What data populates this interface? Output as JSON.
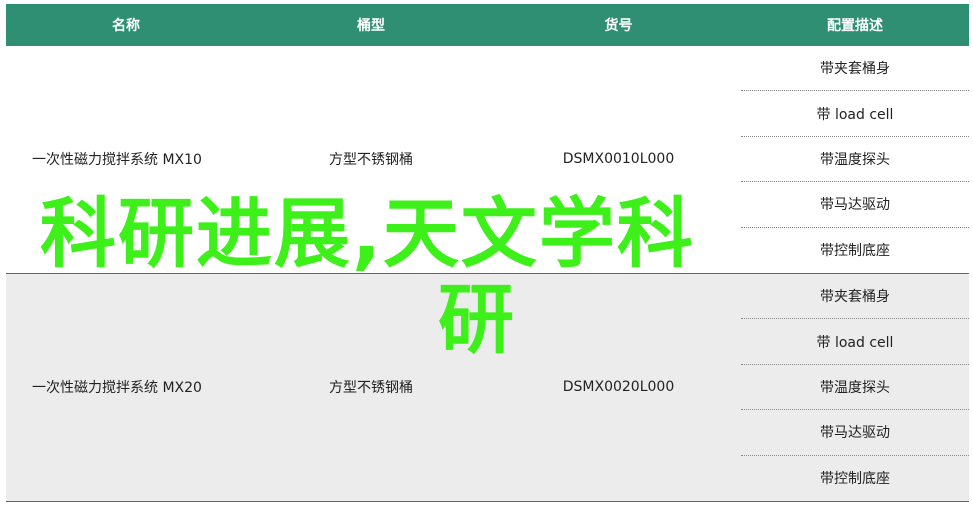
{
  "table": {
    "headers": [
      "名称",
      "桶型",
      "货号",
      "配置描述"
    ],
    "groups": [
      {
        "name": "一次性磁力搅拌系统 MX10",
        "barrel": "方型不锈钢桶",
        "sku": "DSMX0010L000",
        "configs": [
          "带夹套桶身",
          "带 load cell",
          "带温度探头",
          "带马达驱动",
          "带控制底座"
        ]
      },
      {
        "name": "一次性磁力搅拌系统 MX20",
        "barrel": "方型不锈钢桶",
        "sku": "DSMX0020L000",
        "configs": [
          "带夹套桶身",
          "带 load cell",
          "带温度探头",
          "带马达驱动",
          "带控制底座"
        ]
      }
    ]
  },
  "overlay": {
    "line1": "科研进展,天文学科",
    "line2": "研"
  },
  "colors": {
    "header_bg": "#2f8f73",
    "overlay_text": "#3ef01a",
    "shaded_row": "#ececec"
  }
}
